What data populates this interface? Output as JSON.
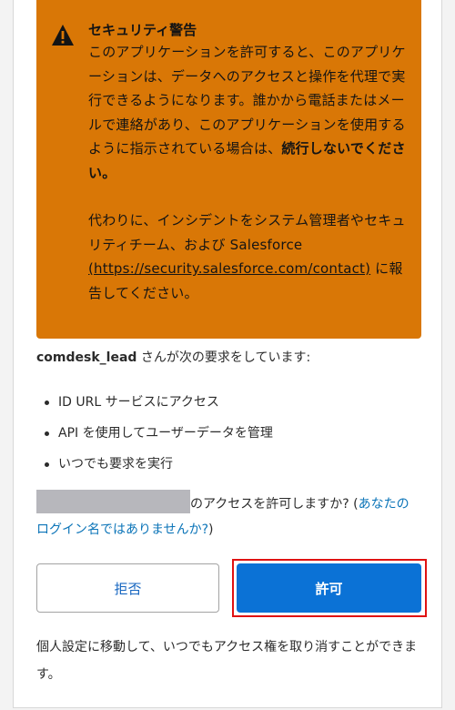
{
  "warning": {
    "icon": "warning-triangle-icon",
    "title": "セキュリティ警告",
    "body_part1": "このアプリケーションを許可すると、このアプリケーションは、データへのアクセスと操作を代理で実行できるようになります。誰かから電話またはメールで連絡があり、このアプリケーションを使用するように指示されている場合は、",
    "body_bold": "続行しないでください。",
    "body2_part1": "代わりに、インシデントをシステム管理者やセキュリティチーム、および Salesforce ",
    "body2_link": "(https://security.salesforce.com/contact)",
    "body2_part2": " に報告してください。"
  },
  "request": {
    "username": "comdesk_lead",
    "suffix": " さんが次の要求をしています:"
  },
  "permissions": [
    "ID URL サービスにアクセス",
    "API を使用してユーザーデータを管理",
    "いつでも要求を実行"
  ],
  "confirm": {
    "question": "のアクセスを許可しますか? (",
    "link": "あなたのログイン名ではありませんか?",
    "close": ")"
  },
  "buttons": {
    "deny": "拒否",
    "allow": "許可"
  },
  "footer_note": "個人設定に移動して、いつでもアクセス権を取り消すことができます。",
  "colors": {
    "warning_bg": "#d97706",
    "allow_bg": "#0b72d6",
    "link": "#0b74b8",
    "highlight": "#e01212"
  }
}
